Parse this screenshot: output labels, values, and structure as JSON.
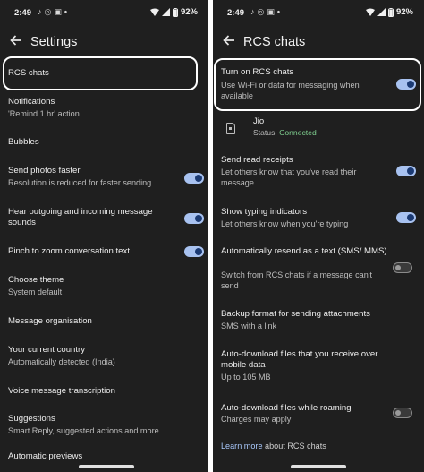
{
  "status_left": {
    "time": "2:49",
    "battery": "92%"
  },
  "status_right": {
    "time": "2:49",
    "battery": "92%"
  },
  "left": {
    "title": "Settings",
    "items": [
      {
        "title": "RCS chats"
      },
      {
        "title": "Notifications",
        "subtitle": "'Remind 1 hr' action"
      },
      {
        "title": "Bubbles"
      },
      {
        "title": "Send photos faster",
        "subtitle": "Resolution is reduced for faster sending",
        "toggle": "on"
      },
      {
        "title": "Hear outgoing and incoming message sounds",
        "toggle": "on"
      },
      {
        "title": "Pinch to zoom conversation text",
        "toggle": "on"
      },
      {
        "title": "Choose theme",
        "subtitle": "System default"
      },
      {
        "title": "Message organisation"
      },
      {
        "title": "Your current country",
        "subtitle": "Automatically detected (India)"
      },
      {
        "title": "Voice message transcription"
      },
      {
        "title": "Suggestions",
        "subtitle": "Smart Reply, suggested actions and more"
      },
      {
        "title": "Automatic previews"
      }
    ]
  },
  "right": {
    "title": "RCS chats",
    "turn_on": {
      "title": "Turn on RCS chats",
      "subtitle": "Use Wi-Fi or data for messaging when available",
      "toggle": "on"
    },
    "sim": {
      "carrier": "Jio",
      "status_label": "Status:",
      "status_value": "Connected",
      "status_color": "#7fcf8f"
    },
    "items": [
      {
        "title": "Send read receipts",
        "subtitle": "Let others know that you've read their message",
        "toggle": "on"
      },
      {
        "title": "Show typing indicators",
        "subtitle": "Let others know when you're typing",
        "toggle": "on"
      },
      {
        "title": "Automatically resend as a text (SMS/ MMS)",
        "subtitle": "Switch from RCS chats if a message can't send",
        "toggle": "off"
      },
      {
        "title": "Backup format for sending attachments",
        "subtitle": "SMS with a link"
      },
      {
        "title": "Auto-download files that you receive over mobile data",
        "subtitle": "Up to 105 MB"
      },
      {
        "title": "Auto-download files while roaming",
        "subtitle": "Charges may apply",
        "toggle": "off"
      }
    ],
    "learn_more": {
      "link": "Learn more",
      "rest": " about RCS chats",
      "link_color": "#a8c7fa"
    }
  }
}
